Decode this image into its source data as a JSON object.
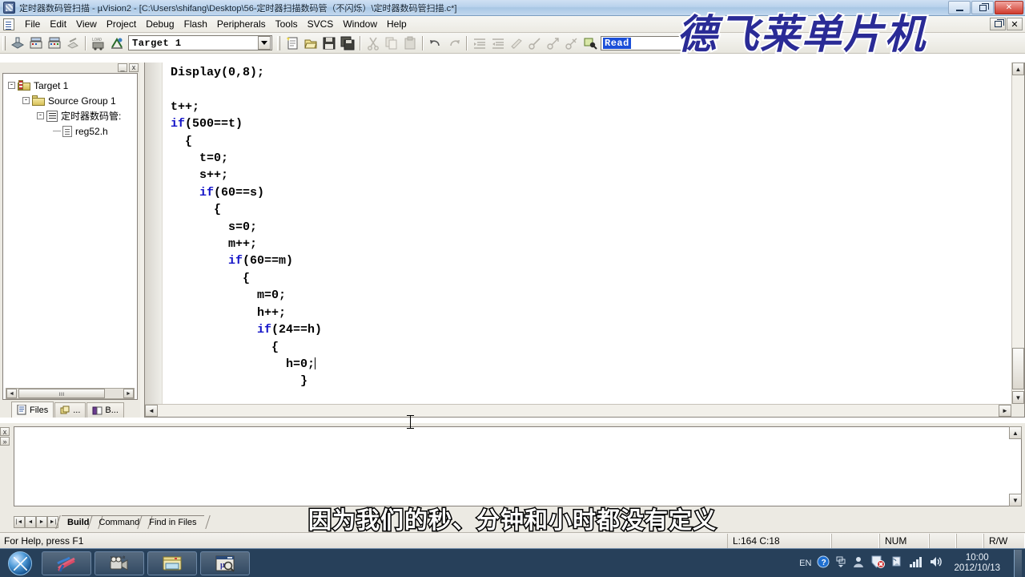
{
  "window": {
    "title": "定时器数码管扫描  - µVision2 - [C:\\Users\\shifang\\Desktop\\56-定时器扫描数码管（不闪烁）\\定时器数码管扫描.c*]",
    "app_icon": "uvision-icon",
    "minimize_label": "Minimize",
    "restore_label": "Restore",
    "close_label": "Close"
  },
  "menubar": {
    "doc_icon": "document-icon",
    "items": [
      {
        "label": "File",
        "accel": "F"
      },
      {
        "label": "Edit",
        "accel": "E"
      },
      {
        "label": "View",
        "accel": "V"
      },
      {
        "label": "Project",
        "accel": "P"
      },
      {
        "label": "Debug",
        "accel": "D"
      },
      {
        "label": "Flash",
        "accel": "l"
      },
      {
        "label": "Peripherals",
        "accel": "r"
      },
      {
        "label": "Tools",
        "accel": "T"
      },
      {
        "label": "SVCS",
        "accel": "S"
      },
      {
        "label": "Window",
        "accel": "W"
      },
      {
        "label": "Help",
        "accel": "H"
      }
    ],
    "mdi_restore_label": "Restore Window",
    "mdi_close_label": "Close Window"
  },
  "toolbar": {
    "target_combo_value": "Target 1",
    "find_box_value": "Read",
    "buttons": [
      "translate-icon",
      "build-target-icon",
      "rebuild-all-icon",
      "stop-build-icon",
      "load-icon",
      "target-options-icon",
      "new-file-icon",
      "open-file-icon",
      "save-file-icon",
      "save-all-icon",
      "cut-icon",
      "copy-icon",
      "paste-icon",
      "undo-icon",
      "redo-icon",
      "indent-icon",
      "outdent-icon",
      "comment-icon",
      "bookmark-toggle-icon",
      "bookmark-prev-icon",
      "bookmark-clear-icon",
      "find-in-files-icon"
    ]
  },
  "watermark": {
    "text": "德飞莱单片机",
    "color": "#2a2b96",
    "outline": "#ffffff"
  },
  "project_panel": {
    "minimize_label": "_",
    "close_label": "x",
    "tree": [
      {
        "label": "Target 1",
        "icon": "target-icon",
        "depth": 0,
        "expander": "-"
      },
      {
        "label": "Source Group 1",
        "icon": "folder-icon",
        "depth": 1,
        "expander": "-"
      },
      {
        "label": "定时器数码管:",
        "icon": "c-file-icon",
        "depth": 2,
        "expander": "-"
      },
      {
        "label": "reg52.h",
        "icon": "h-file-icon",
        "depth": 3,
        "expander": ""
      }
    ],
    "hscroll_thumb_label": "ııı",
    "tabs": [
      {
        "label": "Files",
        "icon": "files-icon",
        "active": true
      },
      {
        "label": "...",
        "icon": "regs-icon",
        "active": false
      },
      {
        "label": "B...",
        "icon": "books-icon",
        "active": false
      }
    ]
  },
  "editor": {
    "lines": [
      {
        "indent": 0,
        "segments": [
          {
            "t": "Display(0,8);",
            "k": false
          }
        ]
      },
      {
        "indent": 0,
        "segments": [
          {
            "t": "",
            "k": false
          }
        ]
      },
      {
        "indent": 0,
        "segments": [
          {
            "t": "t++;",
            "k": false
          }
        ]
      },
      {
        "indent": 0,
        "segments": [
          {
            "t": "if",
            "k": true
          },
          {
            "t": "(500==t)",
            "k": false
          }
        ]
      },
      {
        "indent": 1,
        "segments": [
          {
            "t": "{",
            "k": false
          }
        ]
      },
      {
        "indent": 2,
        "segments": [
          {
            "t": "t=0;",
            "k": false
          }
        ]
      },
      {
        "indent": 2,
        "segments": [
          {
            "t": "s++;",
            "k": false
          }
        ]
      },
      {
        "indent": 2,
        "segments": [
          {
            "t": "if",
            "k": true
          },
          {
            "t": "(60==s)",
            "k": false
          }
        ]
      },
      {
        "indent": 3,
        "segments": [
          {
            "t": "{",
            "k": false
          }
        ]
      },
      {
        "indent": 4,
        "segments": [
          {
            "t": "s=0;",
            "k": false
          }
        ]
      },
      {
        "indent": 4,
        "segments": [
          {
            "t": "m++;",
            "k": false
          }
        ]
      },
      {
        "indent": 4,
        "segments": [
          {
            "t": "if",
            "k": true
          },
          {
            "t": "(60==m)",
            "k": false
          }
        ]
      },
      {
        "indent": 5,
        "segments": [
          {
            "t": "{",
            "k": false
          }
        ]
      },
      {
        "indent": 6,
        "segments": [
          {
            "t": "m=0;",
            "k": false
          }
        ]
      },
      {
        "indent": 6,
        "segments": [
          {
            "t": "h++;",
            "k": false
          }
        ]
      },
      {
        "indent": 6,
        "segments": [
          {
            "t": "if",
            "k": true
          },
          {
            "t": "(24==h)",
            "k": false
          }
        ]
      },
      {
        "indent": 7,
        "segments": [
          {
            "t": "{",
            "k": false
          }
        ]
      },
      {
        "indent": 8,
        "segments": [
          {
            "t": "h=0;",
            "k": false,
            "caret": true
          }
        ]
      },
      {
        "indent": 9,
        "segments": [
          {
            "t": "}",
            "k": false
          }
        ]
      },
      {
        "indent": 0,
        "segments": [
          {
            "t": "",
            "k": false
          }
        ]
      },
      {
        "indent": 4,
        "segments": [
          {
            "t": "}",
            "k": false
          }
        ]
      }
    ],
    "keyword_color": "#1414c8",
    "text_color": "#000000",
    "cursor_icon": "text-ibeam-cursor"
  },
  "output_panel": {
    "close_label": "x",
    "expand_label": "»",
    "content": "",
    "nav_buttons": [
      "first-tab-icon",
      "prev-tab-icon",
      "next-tab-icon",
      "last-tab-icon"
    ],
    "tabs": [
      {
        "label": "Build",
        "active": true
      },
      {
        "label": "Command",
        "active": false
      },
      {
        "label": "Find in Files",
        "active": false
      }
    ]
  },
  "subtitle": {
    "text": "因为我们的秒、分钟和小时都没有定义"
  },
  "statusbar": {
    "help_text": "For Help, press F1",
    "cells": [
      "L:164 C:18",
      "",
      "NUM",
      "",
      "",
      "R/W"
    ]
  },
  "taskbar": {
    "start_label": "Start",
    "tasks": [
      "network-app-icon",
      "camera-recorder-icon",
      "file-explorer-icon",
      "uvision-icon"
    ],
    "tray": {
      "language": "EN",
      "icons": [
        "help-icon",
        "show-hidden-icon",
        "media-icon",
        "security-alert-icon",
        "action-center-icon",
        "network-signal-icon",
        "volume-icon"
      ],
      "time": "10:00",
      "date": "2012/10/13"
    }
  }
}
